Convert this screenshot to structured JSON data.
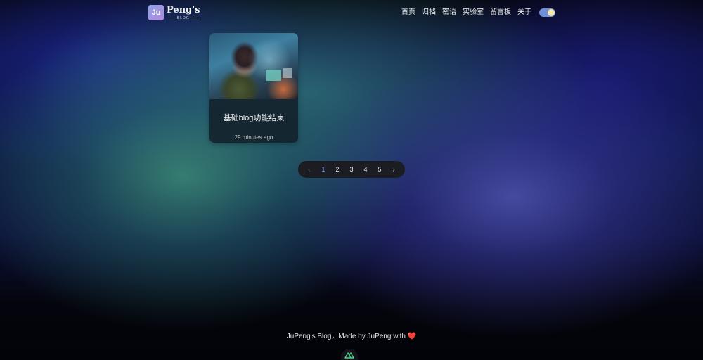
{
  "header": {
    "logo_badge": "Ju",
    "logo_name": "Peng's",
    "logo_sub": "BLOG",
    "nav": [
      "首页",
      "归档",
      "密语",
      "实验室",
      "留言板",
      "关于"
    ],
    "theme_toggle": {
      "state": "dark"
    }
  },
  "posts": [
    {
      "title": "基础blog功能结束",
      "time": "29 minutes ago"
    }
  ],
  "pagination": {
    "prev": "‹",
    "pages": [
      "1",
      "2",
      "3",
      "4",
      "5"
    ],
    "active": "1",
    "next": "›"
  },
  "footer": {
    "text": "JuPeng's Blog，Made by JuPeng with",
    "heart": "❤️"
  },
  "colors": {
    "accent": "#6b9bff",
    "toggle": "#6f8fd6",
    "heart": "#e8364a"
  }
}
